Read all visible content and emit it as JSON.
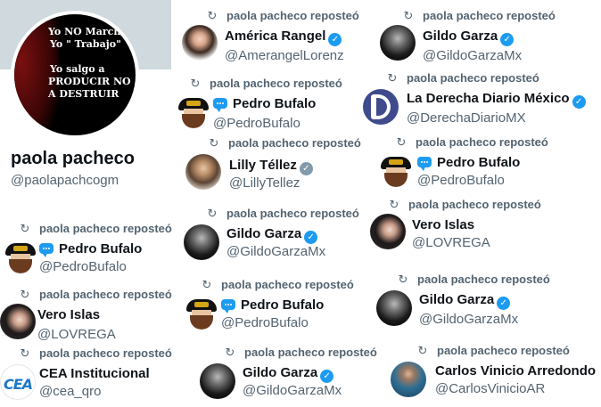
{
  "profile": {
    "name": "paola pacheco",
    "handle": "@paolapachcogm",
    "avatar_text": [
      "Yo NO Marcho",
      "Yo \" Trabajo\"",
      "Yo salgo a",
      "PRODUCIR NO",
      "A DESTRUIR"
    ]
  },
  "repost_label": "paola pacheco reposteó",
  "icons": {
    "repost": "repost-icon",
    "verified": "verified-badge-icon",
    "speech": "speech-bubble-icon"
  },
  "colors": {
    "verified_blue": "#1d9bf0",
    "verified_gray": "#829aab",
    "secondary_text": "#536471"
  },
  "cards": [
    {
      "id": "america",
      "name": "América Rangel",
      "handle": "@AmerangelLorenz",
      "badge": "blue",
      "speech": false
    },
    {
      "id": "gildo1",
      "name": "Gildo Garza",
      "handle": "@GildoGarzaMx",
      "badge": "blue",
      "speech": false
    },
    {
      "id": "bufalo1",
      "name": "Pedro Bufalo",
      "handle": "@PedroBufalo",
      "badge": "none",
      "speech": true
    },
    {
      "id": "derecha",
      "name": "La Derecha Diario México",
      "handle": "@DerechaDiarioMX",
      "badge": "blue",
      "speech": false
    },
    {
      "id": "lilly",
      "name": "Lilly Téllez",
      "handle": "@LillyTellez",
      "badge": "gray",
      "speech": false
    },
    {
      "id": "bufalo2",
      "name": "Pedro Bufalo",
      "handle": "@PedroBufalo",
      "badge": "none",
      "speech": true
    },
    {
      "id": "bufalo3",
      "name": "Pedro Bufalo",
      "handle": "@PedroBufalo",
      "badge": "none",
      "speech": true
    },
    {
      "id": "gildo2",
      "name": "Gildo Garza",
      "handle": "@GildoGarzaMx",
      "badge": "blue",
      "speech": false
    },
    {
      "id": "vero1",
      "name": "Vero Islas",
      "handle": "@LOVREGA",
      "badge": "none",
      "speech": false
    },
    {
      "id": "vero2",
      "name": "Vero Islas",
      "handle": "@LOVREGA",
      "badge": "none",
      "speech": false
    },
    {
      "id": "bufalo4",
      "name": "Pedro Bufalo",
      "handle": "@PedroBufalo",
      "badge": "none",
      "speech": true
    },
    {
      "id": "gildo3",
      "name": "Gildo Garza",
      "handle": "@GildoGarzaMx",
      "badge": "blue",
      "speech": false
    },
    {
      "id": "cea",
      "name": "CEA Institucional",
      "handle": "@cea_qro",
      "badge": "none",
      "speech": false
    },
    {
      "id": "gildo4",
      "name": "Gildo Garza",
      "handle": "@GildoGarzaMx",
      "badge": "blue",
      "speech": false
    },
    {
      "id": "carlos",
      "name": "Carlos Vinicio Arredondo",
      "handle": "@CarlosVinicioAR",
      "badge": "none",
      "speech": false
    }
  ]
}
